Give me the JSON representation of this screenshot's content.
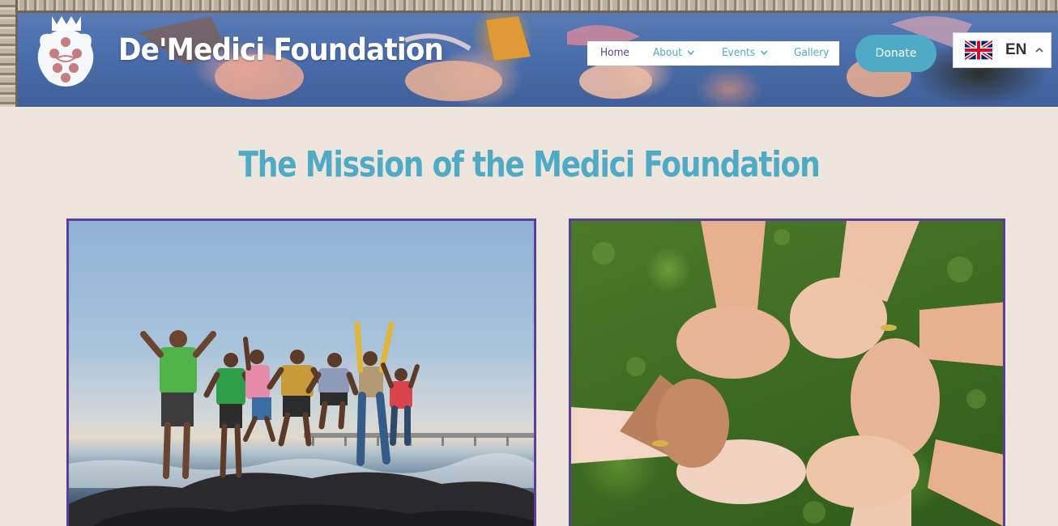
{
  "header": {
    "site_title": "De'Medici Foundation",
    "logo_icon": "medici-crest-icon",
    "nav": {
      "items": [
        {
          "label": "Home",
          "active": true,
          "has_dropdown": false
        },
        {
          "label": "About",
          "active": false,
          "has_dropdown": true
        },
        {
          "label": "Events",
          "active": false,
          "has_dropdown": true
        },
        {
          "label": "Gallery",
          "active": false,
          "has_dropdown": false
        }
      ]
    },
    "donate_label": "Donate",
    "language": {
      "code": "EN",
      "flag_icon": "uk-flag-icon"
    }
  },
  "main": {
    "heading": "The Mission of the Medici Foundation",
    "photos": [
      {
        "subject": "children jumping on rocks by the sea"
      },
      {
        "subject": "hands holding wrists in a circle over grass"
      }
    ]
  },
  "colors": {
    "accent": "#4FAAC6",
    "nav_active": "#5A3E97",
    "photo_border": "#5A3E97",
    "page_background": "#EEE6DC"
  }
}
